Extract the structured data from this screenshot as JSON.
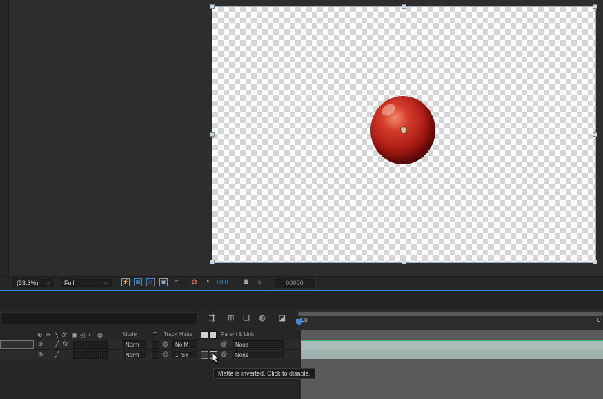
{
  "viewer": {
    "zoom": "(33.3%)",
    "resolution": "Full",
    "exposure": "+0.0",
    "frame": "00000"
  },
  "timeline": {
    "ruler_start": "0:00",
    "ruler_end": "0",
    "columns": {
      "mode": "Mode",
      "t": "T",
      "track_matte": "Track Matte",
      "parent_link": "Parent & Link"
    },
    "switches": [
      "⊕",
      "✳",
      "╲",
      "fx",
      "▣",
      "◎",
      "◐",
      "◍"
    ],
    "layers": [
      {
        "mode": "Norm",
        "matte": "No M",
        "parent": "None"
      },
      {
        "mode": "Norm",
        "matte": "1. SY",
        "parent": "None"
      }
    ]
  },
  "tooltip": "Matte is inverted. Click to disable.",
  "colors": {
    "accent": "#2d8ceb",
    "bar_green": "#2db86a"
  }
}
